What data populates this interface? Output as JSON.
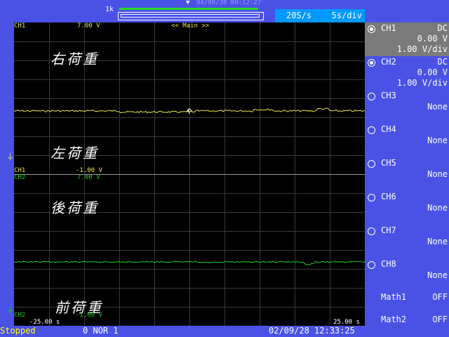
{
  "header": {
    "record_length": "1k",
    "date_top": "94/08/30 09:12:27",
    "sample_rate": "20S/s",
    "time_div": "5s/div"
  },
  "screen": {
    "main_label": "<< Main >>",
    "upper": {
      "ch_label": "CH1",
      "top_value": "7.00 V",
      "bottom_value": "-1.00 V",
      "title_top": "右荷重",
      "title_bottom": "左荷重"
    },
    "lower": {
      "ch_label": "CH2",
      "top_value": "7.00 V",
      "bottom_value": "-1.00 V",
      "title_top": "後荷重",
      "title_bottom": "前荷重"
    },
    "time_left": "-25.00 s",
    "time_right": "25.00 s"
  },
  "panel": {
    "channels": [
      {
        "name": "CH1",
        "coupling": "DC",
        "offset": "0.00 V",
        "vdiv": "1.00 V/div",
        "active": true
      },
      {
        "name": "CH2",
        "coupling": "DC",
        "offset": "0.00 V",
        "vdiv": "1.00 V/div",
        "active": true
      },
      {
        "name": "CH3",
        "state": "None"
      },
      {
        "name": "CH4",
        "state": "None"
      },
      {
        "name": "CH5",
        "state": "None"
      },
      {
        "name": "CH6",
        "state": "None"
      },
      {
        "name": "CH7",
        "state": "None"
      },
      {
        "name": "CH8",
        "state": "None"
      }
    ],
    "math": [
      {
        "name": "Math1",
        "state": "OFF"
      },
      {
        "name": "Math2",
        "state": "OFF"
      }
    ]
  },
  "footer": {
    "status": "Stopped",
    "acq_mode": "0 NOR 1",
    "timestamp": "02/09/28 12:33:25"
  },
  "colors": {
    "ch1": "#e6e64a",
    "ch2": "#22cc22",
    "background": "#4a52e6",
    "rate_box": "#0099ff"
  }
}
